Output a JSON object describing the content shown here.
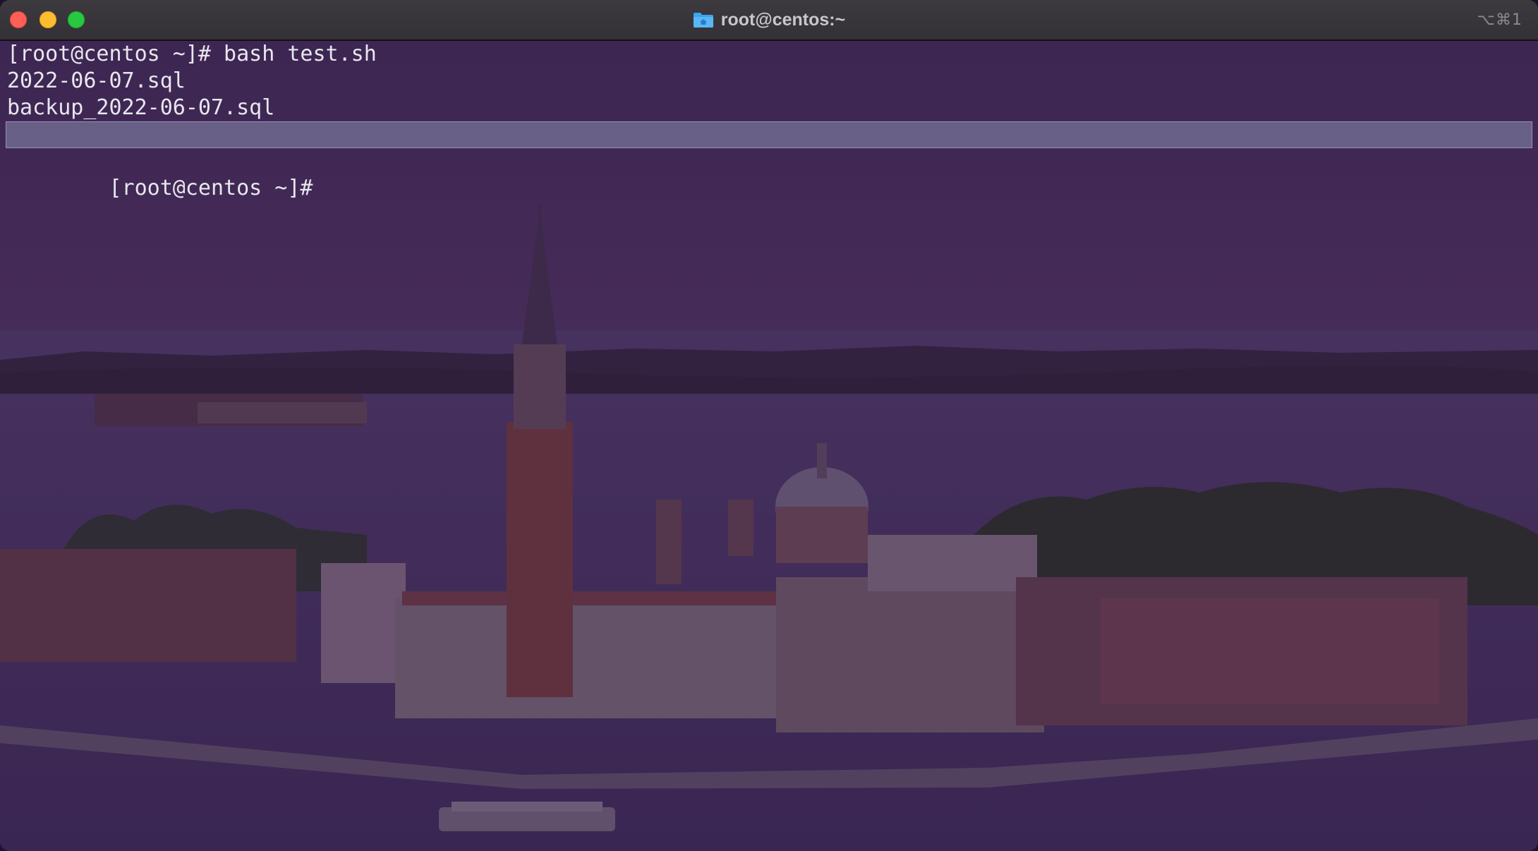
{
  "window": {
    "title": "root@centos:~",
    "shortcut": "⌥⌘1",
    "title_icon": "folder-home-icon"
  },
  "terminal": {
    "lines": [
      "[root@centos ~]# bash test.sh",
      "2022-06-07.sql",
      "backup_2022-06-07.sql"
    ],
    "prompt": "[root@centos ~]#"
  },
  "colors": {
    "text": "#e8e6ee",
    "selection": "#8f9bb8",
    "titlebar": "#3a373c",
    "close": "#fe5f57",
    "minimize": "#febc2e",
    "maximize": "#28c840"
  }
}
